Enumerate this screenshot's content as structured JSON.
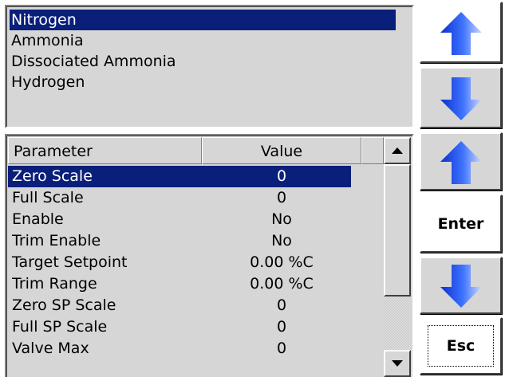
{
  "gas_list": {
    "items": [
      "Nitrogen",
      "Ammonia",
      "Dissociated Ammonia",
      "Hydrogen"
    ],
    "selected_index": 0
  },
  "param_table": {
    "headers": {
      "parameter": "Parameter",
      "value": "Value"
    },
    "rows": [
      {
        "name": "Zero Scale",
        "value": "0"
      },
      {
        "name": "Full Scale",
        "value": "0"
      },
      {
        "name": "Enable",
        "value": "No"
      },
      {
        "name": "Trim Enable",
        "value": "No"
      },
      {
        "name": "Target Setpoint",
        "value": "0.00 %C"
      },
      {
        "name": "Trim Range",
        "value": "0.00 %C"
      },
      {
        "name": "Zero SP Scale",
        "value": "0"
      },
      {
        "name": "Full SP Scale",
        "value": "0"
      },
      {
        "name": "Valve Max",
        "value": "0"
      }
    ],
    "selected_index": 0
  },
  "side_buttons": {
    "enter_label": "Enter",
    "esc_label": "Esc"
  },
  "icons": {
    "gas_up": "blue-up-arrow-icon",
    "gas_down": "blue-down-arrow-icon",
    "param_up": "blue-up-arrow-icon",
    "param_down": "blue-down-arrow-icon",
    "scroll_up": "scroll-up-triangle-icon",
    "scroll_down": "scroll-down-triangle-icon"
  },
  "colors": {
    "selection": "#0a1f7a",
    "panel": "#d6d6d6",
    "arrow_blue": "#1a4fe0"
  }
}
